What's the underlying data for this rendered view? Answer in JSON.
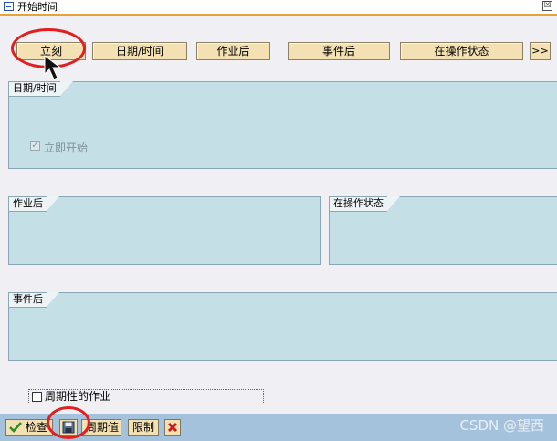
{
  "window": {
    "title": "开始时间",
    "close_glyph": "☒"
  },
  "buttons": {
    "immediate": "立刻",
    "datetime": "日期/时间",
    "after_job": "作业后",
    "after_event": "事件后",
    "at_operation_mode": "在操作状态",
    "more": ">>"
  },
  "groups": {
    "datetime": {
      "title": "日期/时间",
      "immediate_start_label": "立即开始",
      "immediate_start_checked": true
    },
    "after_job": {
      "title": "作业后"
    },
    "at_operation_mode": {
      "title": "在操作状态"
    },
    "after_event": {
      "title": "事件后"
    }
  },
  "periodic_job": {
    "label": "周期性的作业",
    "checked": false
  },
  "toolbar": {
    "check_label": "检查",
    "period_values_label": "周期值",
    "restrictions_label": "限制"
  },
  "watermark": "CSDN @望西",
  "icons": {
    "check": "check-icon",
    "save": "save-icon",
    "cancel": "cancel-icon",
    "window": "window-icon"
  },
  "colors": {
    "button_face": "#f3e1b3",
    "group_fill": "#c5dfe6",
    "toolbar_bg": "#a5c2dd",
    "annotation": "#e02020",
    "cancel_red": "#cc1a1a",
    "check_green": "#2f8a2a"
  }
}
